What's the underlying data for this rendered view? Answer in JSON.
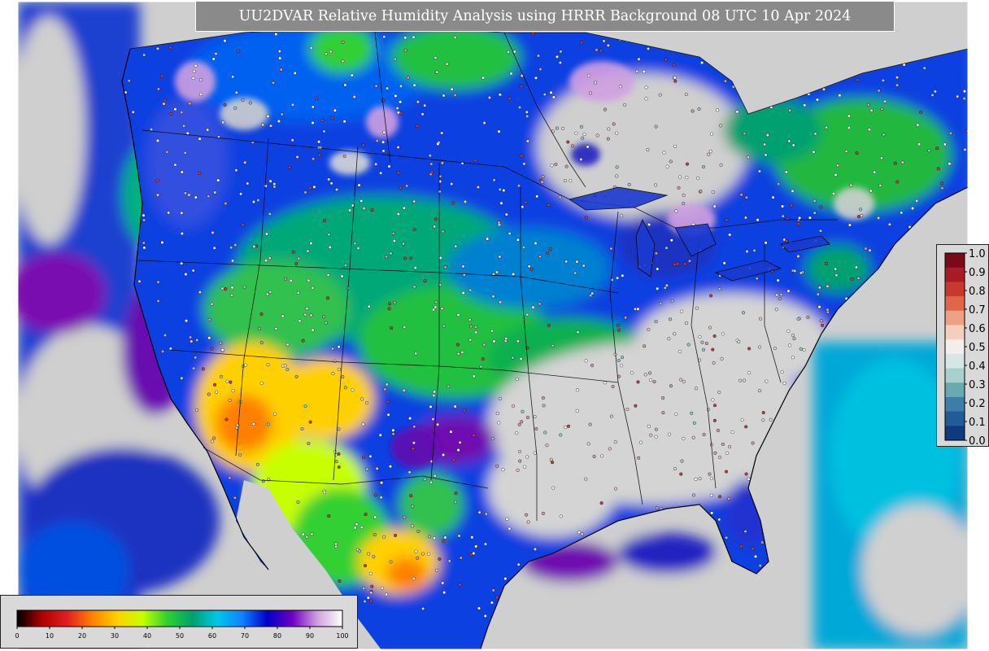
{
  "title": "UU2DVAR Relative Humidity Analysis using HRRR Background 08 UTC 10 Apr 2024",
  "colorbars": {
    "rh": {
      "ticks": [
        "0",
        "10",
        "20",
        "30",
        "40",
        "50",
        "60",
        "70",
        "80",
        "90",
        "100"
      ],
      "colors": [
        "#000000",
        "#b00000",
        "#e02020",
        "#ff8000",
        "#ffd000",
        "#c8ff00",
        "#30d030",
        "#00a070",
        "#00c8e8",
        "#1080ff",
        "#0000c8",
        "#7000c0",
        "#d0a0e0",
        "#ffffff"
      ]
    },
    "fraction": {
      "ticks": [
        "1.0",
        "0.9",
        "0.8",
        "0.7",
        "0.6",
        "0.5",
        "0.4",
        "0.3",
        "0.2",
        "0.1",
        "0.0"
      ],
      "colors": [
        "#7a0a1a",
        "#a81a24",
        "#c8382c",
        "#df6648",
        "#eda084",
        "#f5cfbe",
        "#f1eeec",
        "#d6e6e4",
        "#a8d0cc",
        "#6aa9b0",
        "#3d7da8",
        "#235a98",
        "#103a80"
      ]
    }
  },
  "colors": {
    "ocean_gray": "#cfcfcf",
    "title_bg": "#8a8a8a"
  }
}
